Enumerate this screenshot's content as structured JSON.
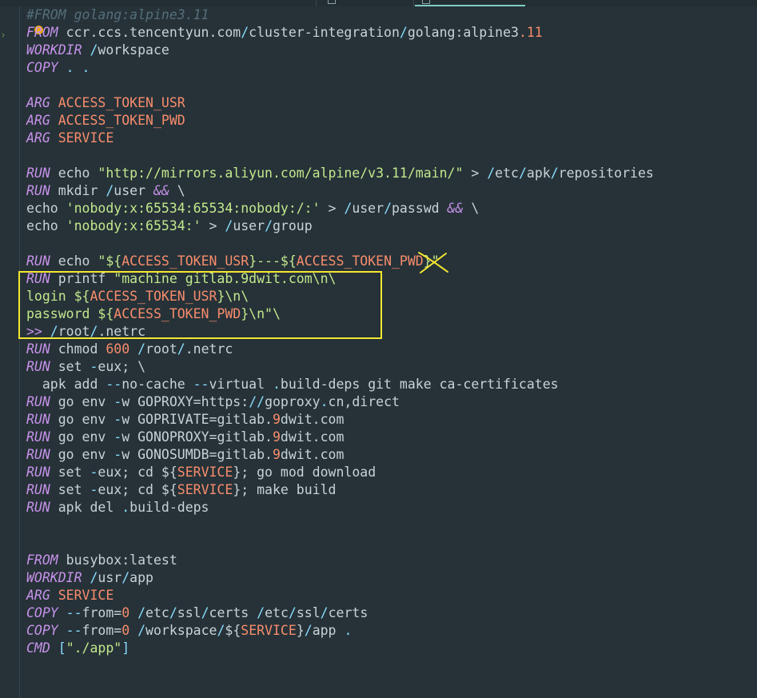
{
  "lines": [
    [
      {
        "t": "#FROM golang:alpine3.11",
        "c": "c"
      }
    ],
    [
      {
        "t": "FROM",
        "c": "kw"
      },
      {
        "t": " ccr.ccs.tencentyun.com",
        "c": "t"
      },
      {
        "t": "/",
        "c": "p"
      },
      {
        "t": "cluster-integration",
        "c": "t"
      },
      {
        "t": "/",
        "c": "p"
      },
      {
        "t": "golang:alpine3",
        "c": "t"
      },
      {
        "t": ".11",
        "c": "v"
      }
    ],
    [
      {
        "t": "WORKDIR",
        "c": "kw"
      },
      {
        "t": " /",
        "c": "p"
      },
      {
        "t": "workspace",
        "c": "t"
      }
    ],
    [
      {
        "t": "COPY",
        "c": "kw"
      },
      {
        "t": " . .",
        "c": "p"
      }
    ],
    [],
    [
      {
        "t": "ARG",
        "c": "kw"
      },
      {
        "t": " ACCESS_TOKEN_USR",
        "c": "v"
      }
    ],
    [
      {
        "t": "ARG",
        "c": "kw"
      },
      {
        "t": " ACCESS_TOKEN_PWD",
        "c": "v"
      }
    ],
    [
      {
        "t": "ARG",
        "c": "kw"
      },
      {
        "t": " SERVICE",
        "c": "v"
      }
    ],
    [],
    [
      {
        "t": "RUN",
        "c": "kw"
      },
      {
        "t": " echo ",
        "c": "t"
      },
      {
        "t": "\"http://mirrors.aliyun.com/alpine/v3.11/main/\"",
        "c": "s"
      },
      {
        "t": " > ",
        "c": "t"
      },
      {
        "t": "/",
        "c": "p"
      },
      {
        "t": "etc",
        "c": "t"
      },
      {
        "t": "/",
        "c": "p"
      },
      {
        "t": "apk",
        "c": "t"
      },
      {
        "t": "/",
        "c": "p"
      },
      {
        "t": "repositories",
        "c": "t"
      }
    ],
    [
      {
        "t": "RUN",
        "c": "kw"
      },
      {
        "t": " mkdir ",
        "c": "t"
      },
      {
        "t": "/",
        "c": "p"
      },
      {
        "t": "user ",
        "c": "t"
      },
      {
        "t": "&&",
        "c": "kw"
      },
      {
        "t": " \\",
        "c": "t"
      }
    ],
    [
      {
        "t": "echo ",
        "c": "t"
      },
      {
        "t": "'nobody:x:65534:65534:nobody:/:'",
        "c": "s"
      },
      {
        "t": " > ",
        "c": "t"
      },
      {
        "t": "/",
        "c": "p"
      },
      {
        "t": "user",
        "c": "t"
      },
      {
        "t": "/",
        "c": "p"
      },
      {
        "t": "passwd ",
        "c": "t"
      },
      {
        "t": "&&",
        "c": "kw"
      },
      {
        "t": " \\",
        "c": "t"
      }
    ],
    [
      {
        "t": "echo ",
        "c": "t"
      },
      {
        "t": "'nobody:x:65534:'",
        "c": "s"
      },
      {
        "t": " > ",
        "c": "t"
      },
      {
        "t": "/",
        "c": "p"
      },
      {
        "t": "user",
        "c": "t"
      },
      {
        "t": "/",
        "c": "p"
      },
      {
        "t": "group",
        "c": "t"
      }
    ],
    [],
    [
      {
        "t": "RUN",
        "c": "kw"
      },
      {
        "t": " echo ",
        "c": "t"
      },
      {
        "t": "\"${",
        "c": "s"
      },
      {
        "t": "ACCESS_TOKEN_USR",
        "c": "v"
      },
      {
        "t": "}---${",
        "c": "s"
      },
      {
        "t": "ACCESS_TOKEN_PWD",
        "c": "v"
      },
      {
        "t": "}\"",
        "c": "s"
      }
    ],
    [
      {
        "t": "RUN",
        "c": "kw"
      },
      {
        "t": " printf ",
        "c": "t"
      },
      {
        "t": "\"machine gitlab.9dwit.com\\n\\",
        "c": "s"
      }
    ],
    [
      {
        "t": "login ${",
        "c": "s"
      },
      {
        "t": "ACCESS_TOKEN_USR",
        "c": "v"
      },
      {
        "t": "}\\n\\",
        "c": "s"
      }
    ],
    [
      {
        "t": "password ${",
        "c": "s"
      },
      {
        "t": "ACCESS_TOKEN_PWD",
        "c": "v"
      },
      {
        "t": "}\\n\"\\",
        "c": "s"
      }
    ],
    [
      {
        "t": ">>",
        "c": "kw"
      },
      {
        "t": " /",
        "c": "p"
      },
      {
        "t": "root",
        "c": "t"
      },
      {
        "t": "/",
        "c": "p"
      },
      {
        "t": ".netrc",
        "c": "t"
      }
    ],
    [
      {
        "t": "RUN",
        "c": "kw"
      },
      {
        "t": " chmod ",
        "c": "t"
      },
      {
        "t": "600",
        "c": "v"
      },
      {
        "t": " /",
        "c": "p"
      },
      {
        "t": "root",
        "c": "t"
      },
      {
        "t": "/",
        "c": "p"
      },
      {
        "t": ".netrc",
        "c": "t"
      }
    ],
    [
      {
        "t": "RUN",
        "c": "kw"
      },
      {
        "t": " set ",
        "c": "t"
      },
      {
        "t": "-",
        "c": "p"
      },
      {
        "t": "eux; \\",
        "c": "t"
      }
    ],
    [
      {
        "t": "  apk add ",
        "c": "t"
      },
      {
        "t": "--",
        "c": "p"
      },
      {
        "t": "no-cache ",
        "c": "t"
      },
      {
        "t": "--",
        "c": "p"
      },
      {
        "t": "virtual ",
        "c": "t"
      },
      {
        "t": ".",
        "c": "p"
      },
      {
        "t": "build-deps git make ca-certificates",
        "c": "t"
      }
    ],
    [
      {
        "t": "RUN",
        "c": "kw"
      },
      {
        "t": " go env ",
        "c": "t"
      },
      {
        "t": "-",
        "c": "p"
      },
      {
        "t": "w GOPROXY=https:",
        "c": "t"
      },
      {
        "t": "//",
        "c": "p"
      },
      {
        "t": "goproxy",
        "c": "t"
      },
      {
        "t": ".",
        "c": "p"
      },
      {
        "t": "cn,direct",
        "c": "t"
      }
    ],
    [
      {
        "t": "RUN",
        "c": "kw"
      },
      {
        "t": " go env ",
        "c": "t"
      },
      {
        "t": "-",
        "c": "p"
      },
      {
        "t": "w GOPRIVATE=gitlab.",
        "c": "t"
      },
      {
        "t": "9",
        "c": "v"
      },
      {
        "t": "dwit.com",
        "c": "t"
      }
    ],
    [
      {
        "t": "RUN",
        "c": "kw"
      },
      {
        "t": " go env ",
        "c": "t"
      },
      {
        "t": "-",
        "c": "p"
      },
      {
        "t": "w GONOPROXY=gitlab.",
        "c": "t"
      },
      {
        "t": "9",
        "c": "v"
      },
      {
        "t": "dwit.com",
        "c": "t"
      }
    ],
    [
      {
        "t": "RUN",
        "c": "kw"
      },
      {
        "t": " go env ",
        "c": "t"
      },
      {
        "t": "-",
        "c": "p"
      },
      {
        "t": "w GONOSUMDB=gitlab.",
        "c": "t"
      },
      {
        "t": "9",
        "c": "v"
      },
      {
        "t": "dwit.com",
        "c": "t"
      }
    ],
    [
      {
        "t": "RUN",
        "c": "kw"
      },
      {
        "t": " set ",
        "c": "t"
      },
      {
        "t": "-",
        "c": "p"
      },
      {
        "t": "eux; cd ${",
        "c": "t"
      },
      {
        "t": "SERVICE",
        "c": "v"
      },
      {
        "t": "}; go mod download",
        "c": "t"
      }
    ],
    [
      {
        "t": "RUN",
        "c": "kw"
      },
      {
        "t": " set ",
        "c": "t"
      },
      {
        "t": "-",
        "c": "p"
      },
      {
        "t": "eux; cd ${",
        "c": "t"
      },
      {
        "t": "SERVICE",
        "c": "v"
      },
      {
        "t": "}; make build",
        "c": "t"
      }
    ],
    [
      {
        "t": "RUN",
        "c": "kw"
      },
      {
        "t": " apk del ",
        "c": "t"
      },
      {
        "t": ".",
        "c": "p"
      },
      {
        "t": "build-deps",
        "c": "t"
      }
    ],
    [],
    [],
    [
      {
        "t": "FROM",
        "c": "kw"
      },
      {
        "t": " busybox:latest",
        "c": "t"
      }
    ],
    [
      {
        "t": "WORKDIR",
        "c": "kw"
      },
      {
        "t": " /",
        "c": "p"
      },
      {
        "t": "usr",
        "c": "t"
      },
      {
        "t": "/",
        "c": "p"
      },
      {
        "t": "app",
        "c": "t"
      }
    ],
    [
      {
        "t": "ARG",
        "c": "kw"
      },
      {
        "t": " SERVICE",
        "c": "v"
      }
    ],
    [
      {
        "t": "COPY",
        "c": "kw"
      },
      {
        "t": " --",
        "c": "p"
      },
      {
        "t": "from=",
        "c": "t"
      },
      {
        "t": "0",
        "c": "v"
      },
      {
        "t": " /",
        "c": "p"
      },
      {
        "t": "etc",
        "c": "t"
      },
      {
        "t": "/",
        "c": "p"
      },
      {
        "t": "ssl",
        "c": "t"
      },
      {
        "t": "/",
        "c": "p"
      },
      {
        "t": "certs ",
        "c": "t"
      },
      {
        "t": "/",
        "c": "p"
      },
      {
        "t": "etc",
        "c": "t"
      },
      {
        "t": "/",
        "c": "p"
      },
      {
        "t": "ssl",
        "c": "t"
      },
      {
        "t": "/",
        "c": "p"
      },
      {
        "t": "certs",
        "c": "t"
      }
    ],
    [
      {
        "t": "COPY",
        "c": "kw"
      },
      {
        "t": " --",
        "c": "p"
      },
      {
        "t": "from=",
        "c": "t"
      },
      {
        "t": "0",
        "c": "v"
      },
      {
        "t": " /",
        "c": "p"
      },
      {
        "t": "workspace",
        "c": "t"
      },
      {
        "t": "/",
        "c": "p"
      },
      {
        "t": "${",
        "c": "t"
      },
      {
        "t": "SERVICE",
        "c": "v"
      },
      {
        "t": "}",
        "c": "t"
      },
      {
        "t": "/",
        "c": "p"
      },
      {
        "t": "app ",
        "c": "t"
      },
      {
        "t": ".",
        "c": "p"
      }
    ],
    [
      {
        "t": "CMD",
        "c": "kw"
      },
      {
        "t": " [",
        "c": "p"
      },
      {
        "t": "\"./app\"",
        "c": "s"
      },
      {
        "t": "]",
        "c": "p"
      }
    ]
  ],
  "colors": {
    "background": "#263238",
    "keyword": "#c792ea",
    "variable": "#f78c6c",
    "string": "#c3e88d",
    "punct": "#89ddff",
    "comment": "#546e7a",
    "highlight_box": "#f5e630",
    "annotation_cross": "#f5e630"
  },
  "icons": {
    "gutter_marker": "bulb-icon",
    "annotation": "cross-mark-icon"
  }
}
